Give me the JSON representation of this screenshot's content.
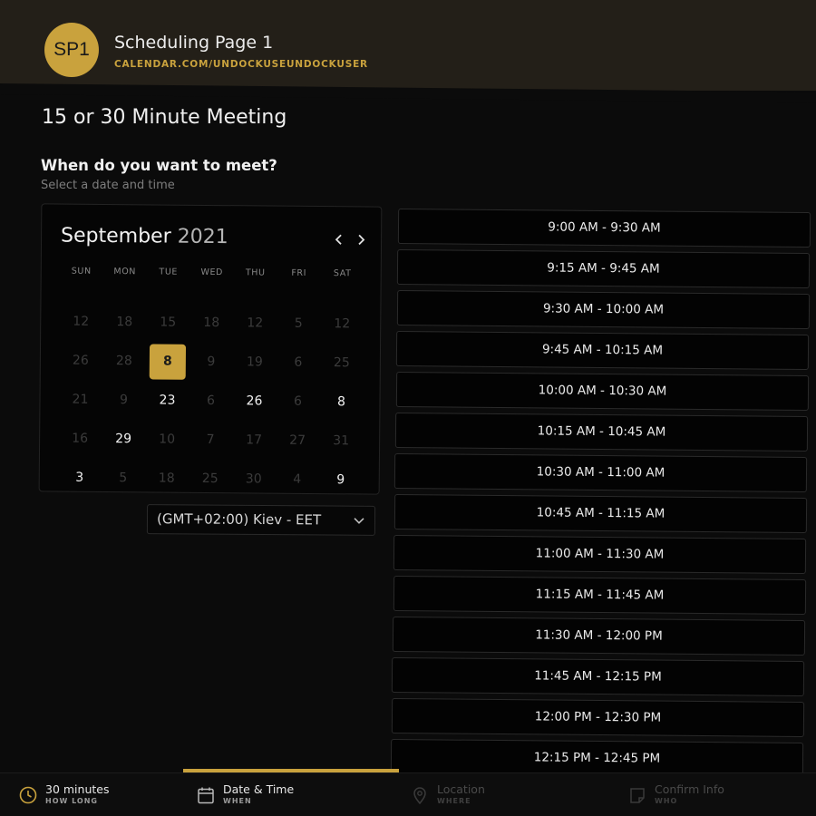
{
  "header": {
    "logo_text": "SP1",
    "page_name": "Scheduling Page 1",
    "url": "CALENDAR.COM/UNDOCKUSEUNDOCKUSER"
  },
  "event": {
    "title": "15 or 30 Minute Meeting",
    "question": "When do you want to meet?",
    "subtitle": "Select a date and time"
  },
  "calendar": {
    "month": "September",
    "year": "2021",
    "prev_icon": "chevron-left-icon",
    "next_icon": "chevron-right-icon",
    "weekdays": [
      "SUN",
      "MON",
      "TUE",
      "WED",
      "THU",
      "FRI",
      "SAT"
    ],
    "weeks": [
      [
        {
          "d": "12",
          "s": "disabled"
        },
        {
          "d": "18",
          "s": "disabled"
        },
        {
          "d": "15",
          "s": "disabled"
        },
        {
          "d": "18",
          "s": "disabled"
        },
        {
          "d": "12",
          "s": "disabled"
        },
        {
          "d": "5",
          "s": "disabled"
        },
        {
          "d": "12",
          "s": "disabled"
        }
      ],
      [
        {
          "d": "26",
          "s": "disabled"
        },
        {
          "d": "28",
          "s": "disabled"
        },
        {
          "d": "8",
          "s": "selected"
        },
        {
          "d": "9",
          "s": "disabled"
        },
        {
          "d": "19",
          "s": "disabled"
        },
        {
          "d": "6",
          "s": "disabled"
        },
        {
          "d": "25",
          "s": "disabled"
        }
      ],
      [
        {
          "d": "21",
          "s": "disabled"
        },
        {
          "d": "9",
          "s": "disabled"
        },
        {
          "d": "23",
          "s": "avail"
        },
        {
          "d": "6",
          "s": "disabled"
        },
        {
          "d": "26",
          "s": "avail"
        },
        {
          "d": "6",
          "s": "disabled"
        },
        {
          "d": "8",
          "s": "avail"
        }
      ],
      [
        {
          "d": "16",
          "s": "disabled"
        },
        {
          "d": "29",
          "s": "avail"
        },
        {
          "d": "10",
          "s": "disabled"
        },
        {
          "d": "7",
          "s": "disabled"
        },
        {
          "d": "17",
          "s": "disabled"
        },
        {
          "d": "27",
          "s": "disabled"
        },
        {
          "d": "31",
          "s": "disabled"
        }
      ],
      [
        {
          "d": "3",
          "s": "avail"
        },
        {
          "d": "5",
          "s": "disabled"
        },
        {
          "d": "18",
          "s": "disabled"
        },
        {
          "d": "25",
          "s": "disabled"
        },
        {
          "d": "30",
          "s": "disabled"
        },
        {
          "d": "4",
          "s": "disabled"
        },
        {
          "d": "9",
          "s": "avail"
        }
      ]
    ]
  },
  "timezone": {
    "selected": "(GMT+02:00) Kiev - EET",
    "icon": "chevron-down-icon"
  },
  "time_slots": [
    "9:00 AM - 9:30 AM",
    "9:15 AM - 9:45 AM",
    "9:30 AM - 10:00 AM",
    "9:45 AM - 10:15 AM",
    "10:00 AM - 10:30 AM",
    "10:15 AM - 10:45 AM",
    "10:30 AM - 11:00 AM",
    "10:45 AM - 11:15 AM",
    "11:00 AM - 11:30 AM",
    "11:15 AM - 11:45 AM",
    "11:30 AM - 12:00 PM",
    "11:45 AM - 12:15 PM",
    "12:00 PM - 12:30 PM",
    "12:15 PM - 12:45 PM"
  ],
  "steps": [
    {
      "label": "30 minutes",
      "sub": "HOW LONG",
      "icon": "clock-icon",
      "state": "done"
    },
    {
      "label": "Date & Time",
      "sub": "WHEN",
      "icon": "calendar-icon",
      "state": "active"
    },
    {
      "label": "Location",
      "sub": "WHERE",
      "icon": "map-pin-icon",
      "state": "todo"
    },
    {
      "label": "Confirm Info",
      "sub": "WHO",
      "icon": "note-icon",
      "state": "todo"
    }
  ],
  "colors": {
    "accent": "#c9a23d",
    "background": "#0b0b0b",
    "header_bg": "#231f18"
  }
}
